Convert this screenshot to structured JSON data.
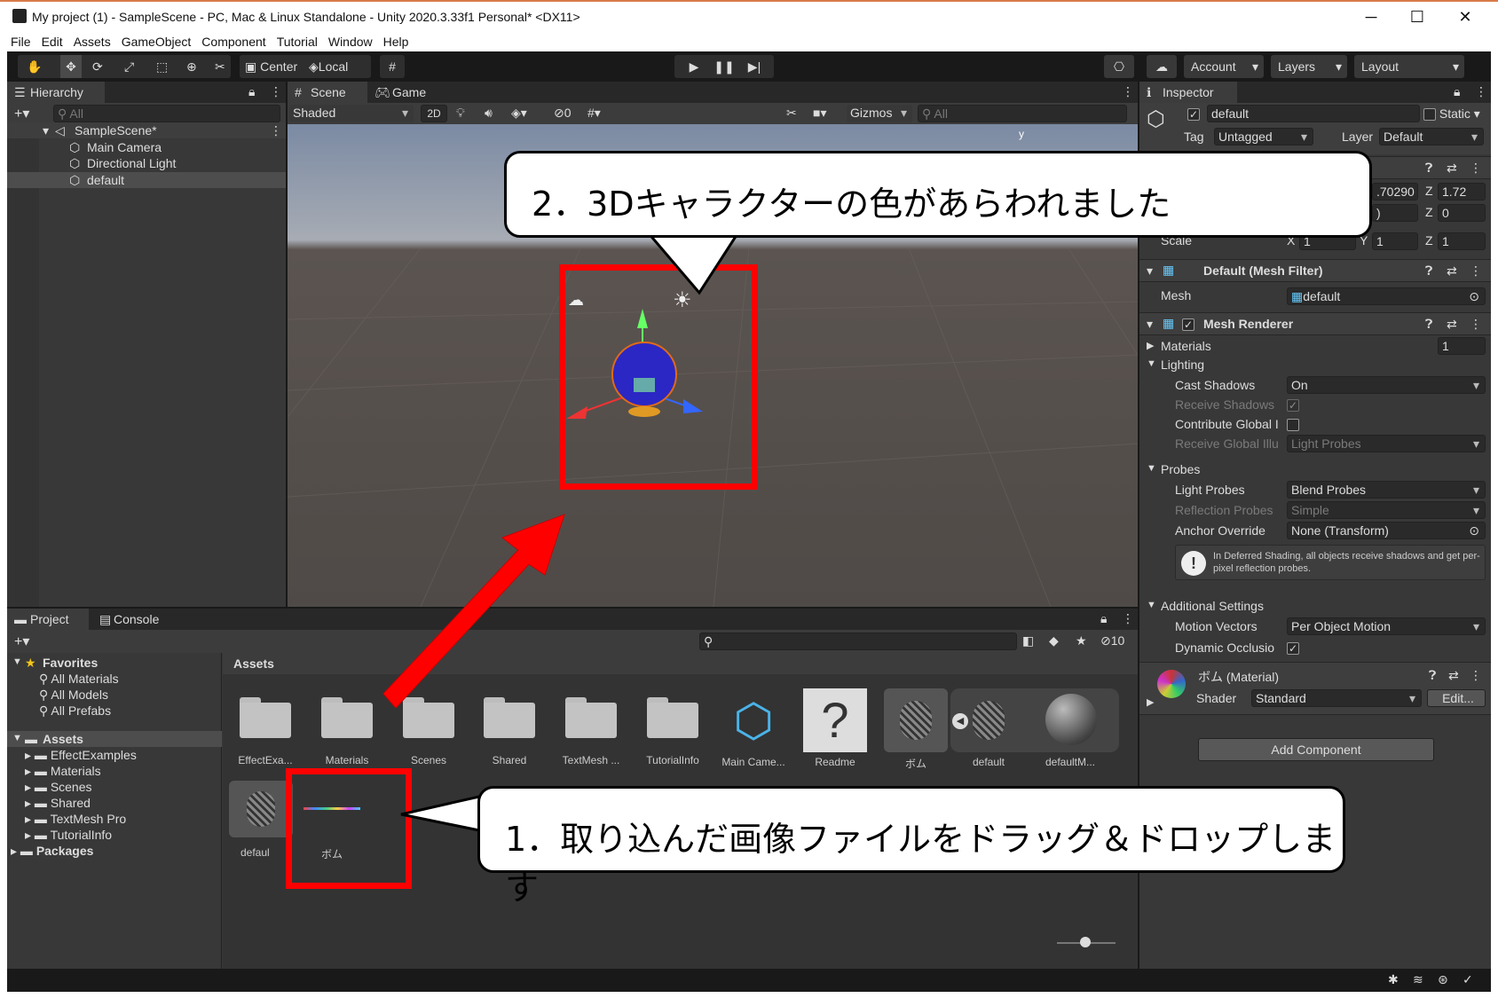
{
  "window": {
    "title": "My project (1) - SampleScene - PC, Mac & Linux Standalone - Unity 2020.3.33f1 Personal* <DX11>",
    "minimize": "─",
    "maximize": "☐",
    "close": "✕"
  },
  "menu": [
    "File",
    "Edit",
    "Assets",
    "GameObject",
    "Component",
    "Tutorial",
    "Window",
    "Help"
  ],
  "toolbar": {
    "pivot": "Center",
    "space": "Local",
    "account": "Account",
    "layers": "Layers",
    "layout": "Layout"
  },
  "hierarchy": {
    "tab": "Hierarchy",
    "search_placeholder": "All",
    "scene": "SampleScene*",
    "items": [
      "Main Camera",
      "Directional Light",
      "default"
    ]
  },
  "scene": {
    "tab_scene": "Scene",
    "tab_game": "Game",
    "shading": "Shaded",
    "mode2d": "2D",
    "hidden_count": "0",
    "gizmos": "Gizmos",
    "search_placeholder": "All"
  },
  "inspector": {
    "tab": "Inspector",
    "object_name": "default",
    "static": "Static",
    "tag_label": "Tag",
    "tag_value": "Untagged",
    "layer_label": "Layer",
    "layer_value": "Default",
    "pos_x": ".70290",
    "pos_z_label": "Z",
    "pos_z": "1.72",
    "rot_tail": ")",
    "rot_z_label": "Z",
    "rot_z": "0",
    "scale_label": "Scale",
    "scale_x_label": "X",
    "scale_x": "1",
    "scale_y_label": "Y",
    "scale_y": "1",
    "scale_z_label": "Z",
    "scale_z": "1",
    "mesh_filter": "Default (Mesh Filter)",
    "mesh_label": "Mesh",
    "mesh_value": "default",
    "mesh_renderer": "Mesh Renderer",
    "materials_label": "Materials",
    "materials_count": "1",
    "lighting": "Lighting",
    "cast_shadows_label": "Cast Shadows",
    "cast_shadows_value": "On",
    "receive_shadows": "Receive Shadows",
    "contribute_gi": "Contribute Global I",
    "receive_gi_label": "Receive Global Illu",
    "receive_gi_value": "Light Probes",
    "probes": "Probes",
    "light_probes_label": "Light Probes",
    "light_probes_value": "Blend Probes",
    "reflection_label": "Reflection Probes",
    "reflection_value": "Simple",
    "anchor_label": "Anchor Override",
    "anchor_value": "None (Transform)",
    "info_text": "In Deferred Shading, all objects receive shadows and get per-pixel reflection probes.",
    "additional": "Additional Settings",
    "motion_label": "Motion Vectors",
    "motion_value": "Per Object Motion",
    "dynamic_occlusion": "Dynamic Occlusio",
    "material_name": "ボム (Material)",
    "shader_label": "Shader",
    "shader_value": "Standard",
    "edit": "Edit...",
    "add_component": "Add Component"
  },
  "project": {
    "tab_project": "Project",
    "tab_console": "Console",
    "hidden_count": "10",
    "favorites": "Favorites",
    "fav_items": [
      "All Materials",
      "All Models",
      "All Prefabs"
    ],
    "assets_root": "Assets",
    "asset_folders": [
      "EffectExamples",
      "Materials",
      "Scenes",
      "Shared",
      "TextMesh Pro",
      "TutorialInfo"
    ],
    "packages": "Packages",
    "breadcrumb": "Assets",
    "grid_row1": [
      "EffectExa...",
      "Materials",
      "Scenes",
      "Shared",
      "TextMesh ...",
      "TutorialInfo",
      "Main Came...",
      "Readme",
      "ボム",
      "default",
      "defaultM..."
    ],
    "grid_row2": [
      "defaul",
      "ボム"
    ]
  },
  "annotations": {
    "callout1": "1．取り込んだ画像ファイルをドラッグ＆ドロップします",
    "callout2": "2．3Dキャラクターの色があらわれました"
  },
  "colors": {
    "highlight": "#ff0000",
    "editor_bg": "#383838",
    "selection": "#2c5d87"
  }
}
